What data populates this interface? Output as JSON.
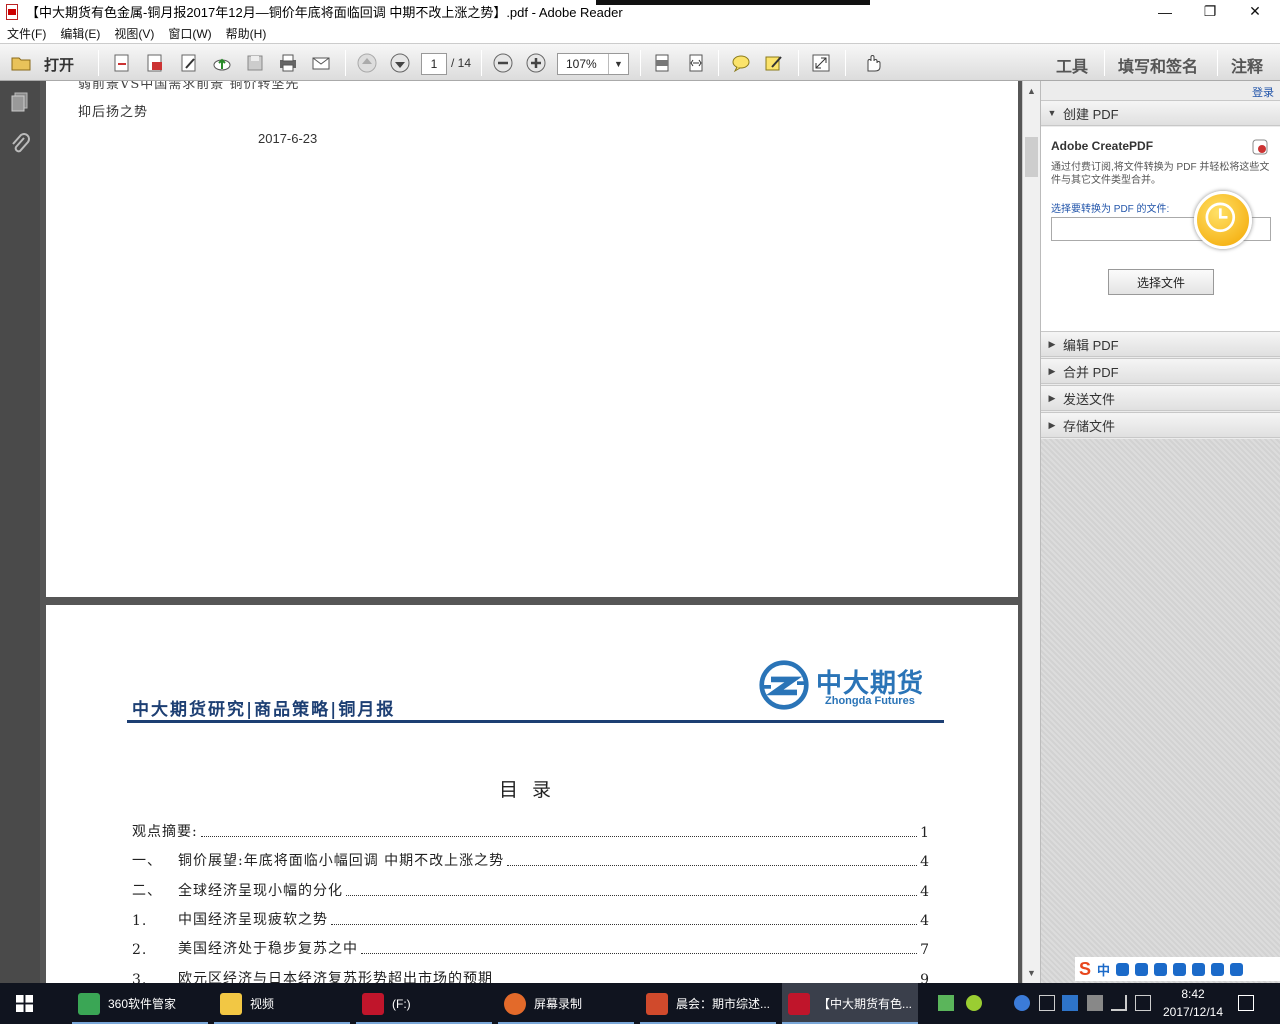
{
  "window": {
    "title": "【中大期货有色金属-铜月报2017年12月—铜价年底将面临回调 中期不改上涨之势】.pdf - Adobe Reader",
    "minimize": "—",
    "maximize": "❐",
    "close": "✕"
  },
  "menu": {
    "items": [
      "文件(F)",
      "编辑(E)",
      "视图(V)",
      "窗口(W)",
      "帮助(H)"
    ]
  },
  "toolbar": {
    "open_label": "打开",
    "page_current": "1",
    "page_total": "/ 14",
    "zoom": "107%",
    "zoom_arrow": "▼",
    "right_tabs": [
      "工具",
      "填写和签名",
      "注释"
    ]
  },
  "document": {
    "page1": {
      "line_cut": "弱前景VS中国需求前景 铜价转坚先",
      "line2": "抑后扬之势",
      "date": "2017-6-23"
    },
    "page2": {
      "header": "中大期货研究|商品策略|铜月报",
      "logo_cn": "中大期货",
      "logo_en": "Zhongda Futures",
      "toc_title": "目录",
      "toc": [
        {
          "num": "",
          "text": "观点摘要:",
          "page": "1"
        },
        {
          "num": "一、",
          "text": "铜价展望:年底将面临小幅回调 中期不改上涨之势",
          "page": "4"
        },
        {
          "num": "二、",
          "text": "全球经济呈现小幅的分化",
          "page": "4"
        },
        {
          "num": "1.",
          "text": "中国经济呈现疲软之势",
          "page": "4"
        },
        {
          "num": "2.",
          "text": "美国经济处于稳步复苏之中",
          "page": "7"
        },
        {
          "num": "3.",
          "text": "欧元区经济与日本经济复苏形势超出市场的预期",
          "page": "9"
        }
      ]
    }
  },
  "right_panel": {
    "signin": "登录",
    "create_pdf": {
      "label": "创建 PDF",
      "title": "Adobe CreatePDF",
      "desc": "通过付费订阅,将文件转换为 PDF 并轻松将这些文件与其它文件类型合并。",
      "select_label": "选择要转换为 PDF 的文件:",
      "button": "选择文件"
    },
    "sections": [
      "编辑 PDF",
      "合并 PDF",
      "发送文件",
      "存储文件"
    ],
    "ime": {
      "logo": "S",
      "mode": "中"
    }
  },
  "taskbar": {
    "items": [
      {
        "label": "360软件管家",
        "color": "#3aa655"
      },
      {
        "label": "视频",
        "color": "#f2c744"
      },
      {
        "label": "(F:)",
        "color": "#c0152b"
      },
      {
        "label": "屏幕录制",
        "color": "#e36a2a"
      },
      {
        "label": "晨会：期市综述...",
        "color": "#d04a2c"
      },
      {
        "label": "【中大期货有色...",
        "color": "#c0152b"
      }
    ],
    "time": "8:42",
    "date": "2017/12/14"
  },
  "colors": {
    "doc_navy": "#1d3f73",
    "logo_blue": "#2a74b7",
    "taskbar": "#10141f"
  }
}
